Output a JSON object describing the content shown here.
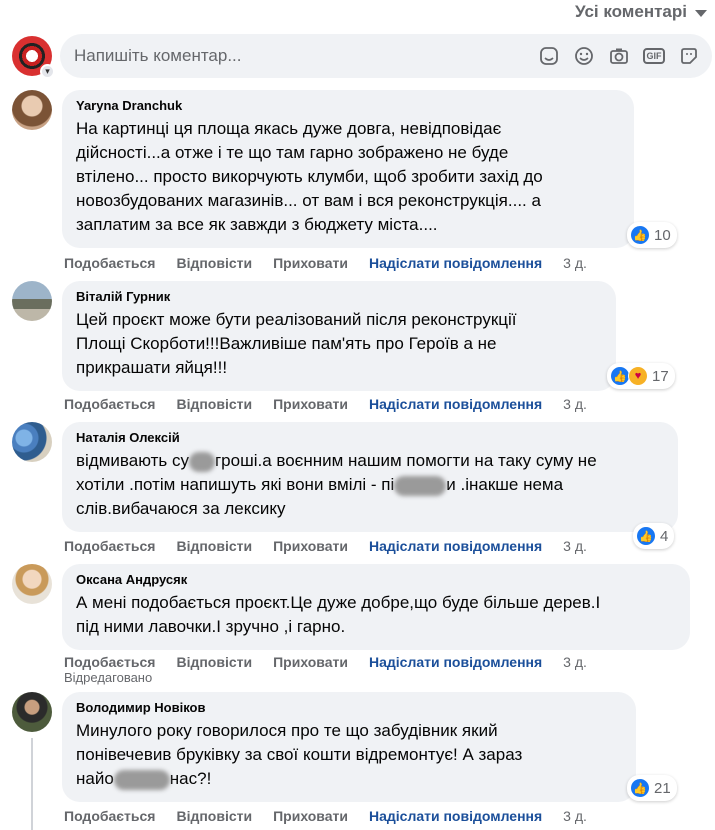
{
  "sort": {
    "label": "Усі коментарі"
  },
  "composer": {
    "placeholder": "Напишіть коментар...",
    "icons": [
      "sticker-icon",
      "emoji-icon",
      "camera-icon",
      "gif-icon",
      "avatar-sticker-icon"
    ],
    "gif_label": "GIF"
  },
  "actions": {
    "like": "Подобається",
    "reply": "Відповісти",
    "hide": "Приховати",
    "message": "Надіслати повідомлення"
  },
  "comments": [
    {
      "author": "Yaryna Dranchuk",
      "lines": [
        "На картинці ця площа якась дуже довга, невідповідає",
        "дійсності...а отже і те що там гарно зображено не буде",
        "втілено... просто викорчують клумби, щоб зробити захід до",
        "новозбудованих магазинів... от вам і вся реконструкція.... а",
        "заплатим за все як завжди з бюджету міста...."
      ],
      "reactions": "10",
      "time": "3 д."
    },
    {
      "author": "Віталій Гурник",
      "lines": [
        "Цей проєкт може бути реалізований після реконструкції",
        "Площі Скорботи!!!Важливіше пам'ять про Героїв а не",
        "прикрашати яйця!!!"
      ],
      "reactions": "17",
      "time": "3 д."
    },
    {
      "author": "Наталія Олексій",
      "lines": [
        "відмивають су",
        "гроші.а воєнним нашим помогти на таку суму не",
        "хотіли .потім напишуть які вони вмілі - пі",
        "и .інакше нема",
        "слів.вибачаюся за лексику"
      ],
      "reactions": "4",
      "time": "3 д."
    },
    {
      "author": "Оксана Андрусяк",
      "lines": [
        "А мені подобається проєкт.Це дуже добре,що буде більше дерев.І",
        "під ними лавочки.І зручно ,і гарно."
      ],
      "time": "3 д.",
      "edited": "Відредаговано"
    },
    {
      "author": "Володимир Новіков",
      "lines": [
        "Минулого року говорилося про те що забудівник який",
        "понівечевив бруківку за свої кошти відремонтує! А зараз",
        "найо",
        "нас?!"
      ],
      "reactions": "21",
      "time": "3 д."
    }
  ]
}
